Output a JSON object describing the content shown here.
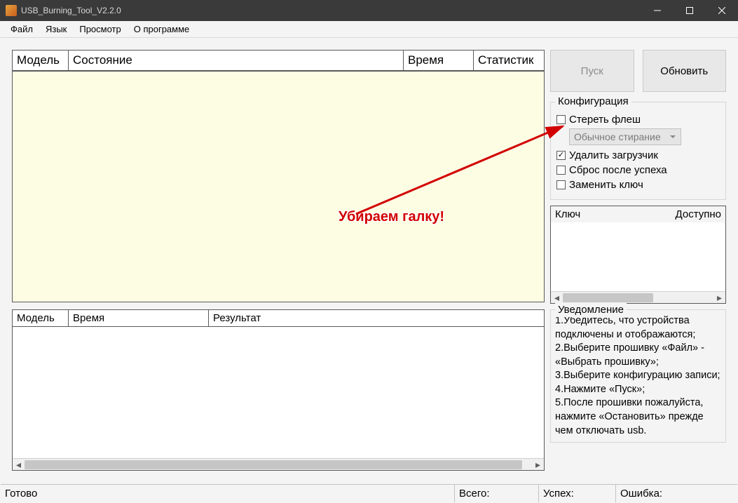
{
  "window": {
    "title": "USB_Burning_Tool_V2.2.0"
  },
  "menu": {
    "file": "Файл",
    "lang": "Язык",
    "view": "Просмотр",
    "about": "О программе"
  },
  "grid1": {
    "col_model": "Модель",
    "col_state": "Состояние",
    "col_time": "Время",
    "col_stats": "Статистик"
  },
  "grid2": {
    "col_model": "Модель",
    "col_time": "Время",
    "col_result": "Результат"
  },
  "buttons": {
    "start": "Пуск",
    "refresh": "Обновить"
  },
  "config": {
    "title": "Конфигурация",
    "erase_flash": "Стереть флеш",
    "erase_mode": "Обычное стирание",
    "erase_bootloader": "Удалить загрузчик",
    "reset_after": "Сброс после успеха",
    "replace_key": "Заменить ключ"
  },
  "keys": {
    "col_key": "Ключ",
    "col_avail": "Доступно"
  },
  "notice": {
    "title": "Уведомление",
    "l1": "1.Убедитесь, что устройства подключены и отображаются;",
    "l2": "2.Выберите прошивку «Файл» - «Выбрать прошивку»;",
    "l3": "3.Выберите конфигурацию записи;",
    "l4": "4.Нажмите «Пуск»;",
    "l5": "5.После прошивки пожалуйста, нажмите «Остановить» прежде чем отключать usb."
  },
  "status": {
    "ready": "Готово",
    "total": "Всего:",
    "success": "Успех:",
    "error": "Ошибка:"
  },
  "annotation": {
    "text": "Убираем галку!"
  }
}
